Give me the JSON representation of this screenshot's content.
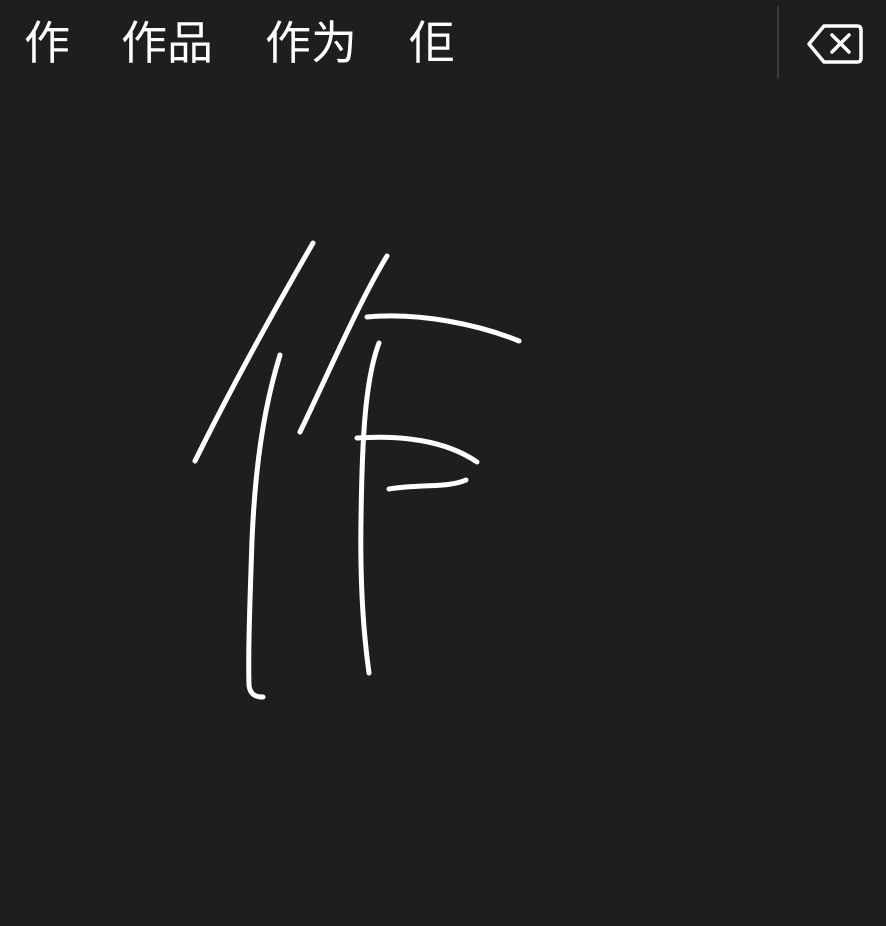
{
  "candidates": [
    "作",
    "作品",
    "作为",
    "佢"
  ],
  "icons": {
    "delete": "delete-backspace-icon"
  },
  "colors": {
    "background": "#1e1d20",
    "text": "#ffffff",
    "divider": "#3a393c",
    "ink": "#ffffff"
  }
}
